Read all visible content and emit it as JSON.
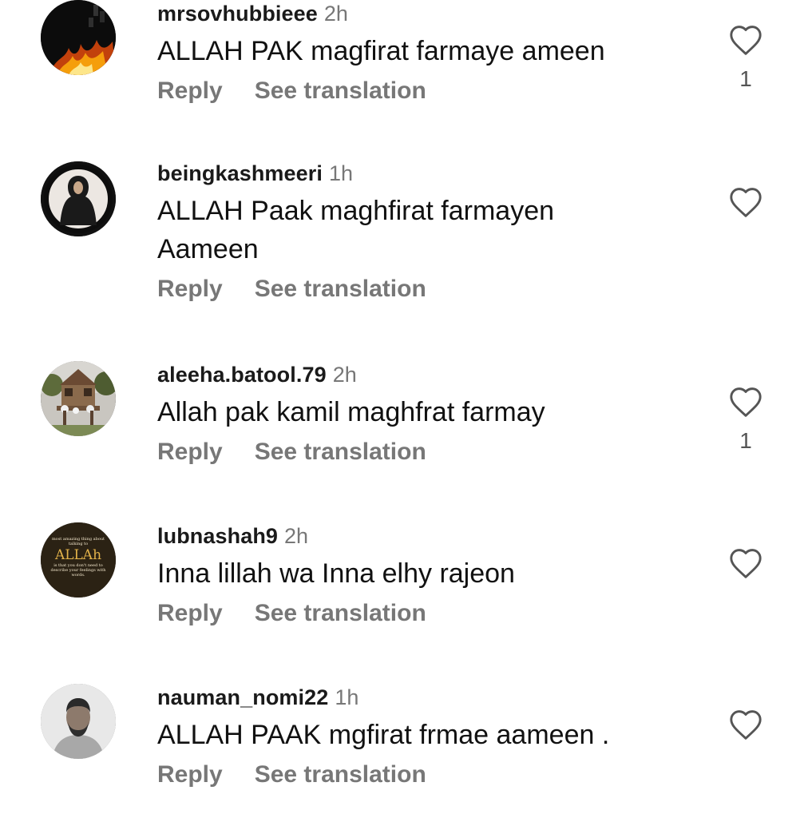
{
  "comments": [
    {
      "username": "mrsovhubbieee",
      "time": "2h",
      "text": "ALLAH PAK magfirat farmaye ameen",
      "reply_label": "Reply",
      "translate_label": "See translation",
      "likes": "1",
      "avatar": "fire-dark-avatar"
    },
    {
      "username": "beingkashmeeri",
      "time": "1h",
      "text": "ALLAH Paak maghfirat farmayen Aameen",
      "reply_label": "Reply",
      "translate_label": "See translation",
      "likes": "",
      "avatar": "hooded-person-avatar"
    },
    {
      "username": "aleeha.batool.79",
      "time": "2h",
      "text": "Allah pak kamil maghfrat farmay",
      "reply_label": "Reply",
      "translate_label": "See translation",
      "likes": "1",
      "avatar": "treehouse-avatar"
    },
    {
      "username": "lubnashah9",
      "time": "2h",
      "text": "Inna lillah wa Inna elhy rajeon",
      "reply_label": "Reply",
      "translate_label": "See translation",
      "likes": "",
      "avatar": "allah-quote-avatar",
      "avatar_text": {
        "line1": "most amazing thing about",
        "line2": "talking to",
        "word": "ALLAh",
        "line3": "is that you don't need to",
        "line4": "describe your feelings with",
        "line5": "words."
      }
    },
    {
      "username": "nauman_nomi22",
      "time": "1h",
      "text": "ALLAH PAAK mgfirat frmae aameen .",
      "reply_label": "Reply",
      "translate_label": "See translation",
      "likes": "",
      "avatar": "man-portrait-avatar"
    }
  ],
  "icons": {
    "like": "heart-outline-icon"
  },
  "colors": {
    "muted": "#777777",
    "text": "#111111",
    "background": "#ffffff"
  }
}
